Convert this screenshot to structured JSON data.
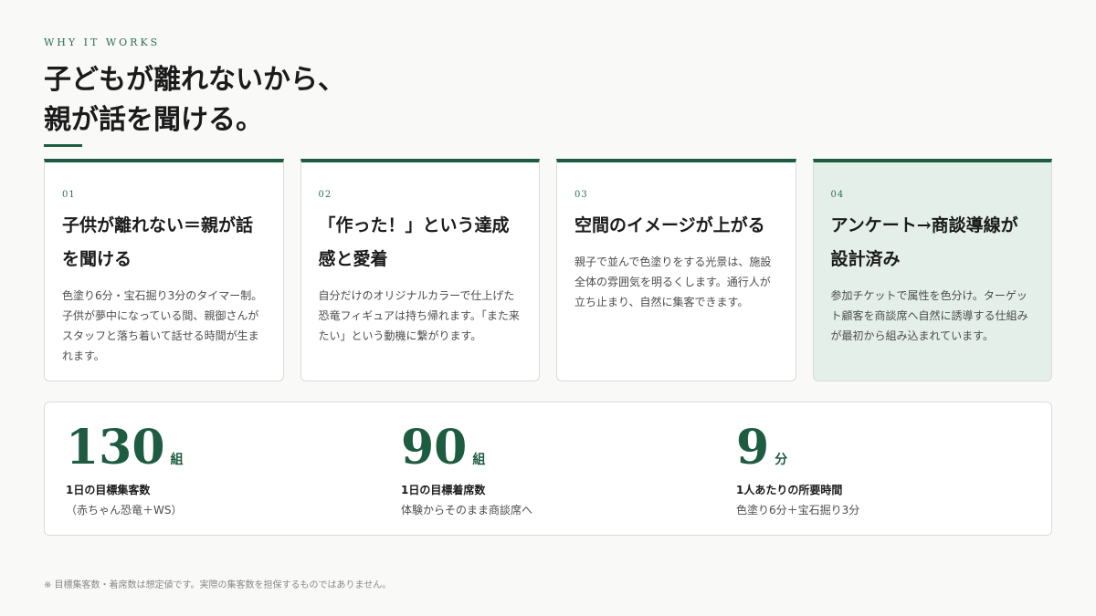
{
  "eyebrow": "WHY IT WORKS",
  "headline": {
    "line1": "子どもが離れないから、",
    "line2": "親が話を聞ける。"
  },
  "cards": [
    {
      "num": "01",
      "title": "子供が離れない＝親が話を聞ける",
      "body": "色塗り6分・宝石掘り3分のタイマー制。子供が夢中になっている間、親御さんがスタッフと落ち着いて話せる時間が生まれます。"
    },
    {
      "num": "02",
      "title": "「作った！」という達成感と愛着",
      "body": "自分だけのオリジナルカラーで仕上げた恐竜フィギュアは持ち帰れます。「また来たい」という動機に繋がります。"
    },
    {
      "num": "03",
      "title": "空間のイメージが上がる",
      "body": "親子で並んで色塗りをする光景は、施設全体の雰囲気を明るくします。通行人が立ち止まり、自然に集客できます。"
    },
    {
      "num": "04",
      "title": "アンケート→商談導線が設計済み",
      "body": "参加チケットで属性を色分け。ターゲット顧客を商談席へ自然に誘導する仕組みが最初から組み込まれています。"
    }
  ],
  "stats": [
    {
      "value": "130",
      "unit": "組",
      "label": "1日の目標集客数",
      "sub": "（赤ちゃん恐竜＋WS）"
    },
    {
      "value": "90",
      "unit": "組",
      "label": "1日の目標着席数",
      "sub": "体験からそのまま商談席へ"
    },
    {
      "value": "9",
      "unit": "分",
      "label": "1人あたりの所要時間",
      "sub": "色塗り6分＋宝石掘り3分"
    }
  ],
  "footnote": "※ 目標集客数・着席数は想定値です。実際の集客数を担保するものではありません。",
  "colors": {
    "accent": "#1e5c41",
    "highlight_card_bg": "#e4efe9",
    "page_bg": "#f9f9f8"
  }
}
